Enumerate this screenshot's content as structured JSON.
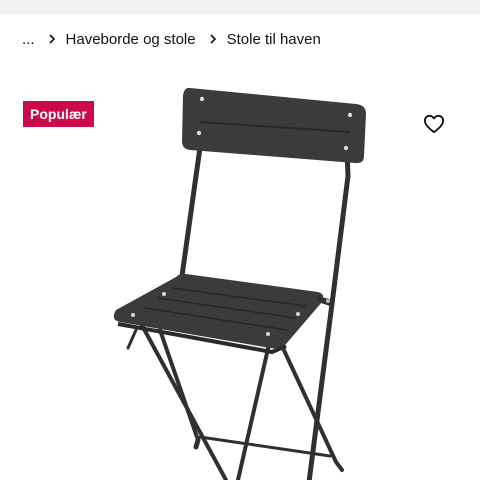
{
  "breadcrumb": {
    "items": [
      {
        "label": "..."
      },
      {
        "label": "Haveborde og stole"
      },
      {
        "label": "Stole til haven"
      }
    ]
  },
  "badge": {
    "label": "Populær",
    "color": "#cc0a4b"
  },
  "favorite": {
    "icon": "heart-icon"
  },
  "product_image": {
    "subject": "folding garden chair",
    "color": "#3a3b3d"
  }
}
